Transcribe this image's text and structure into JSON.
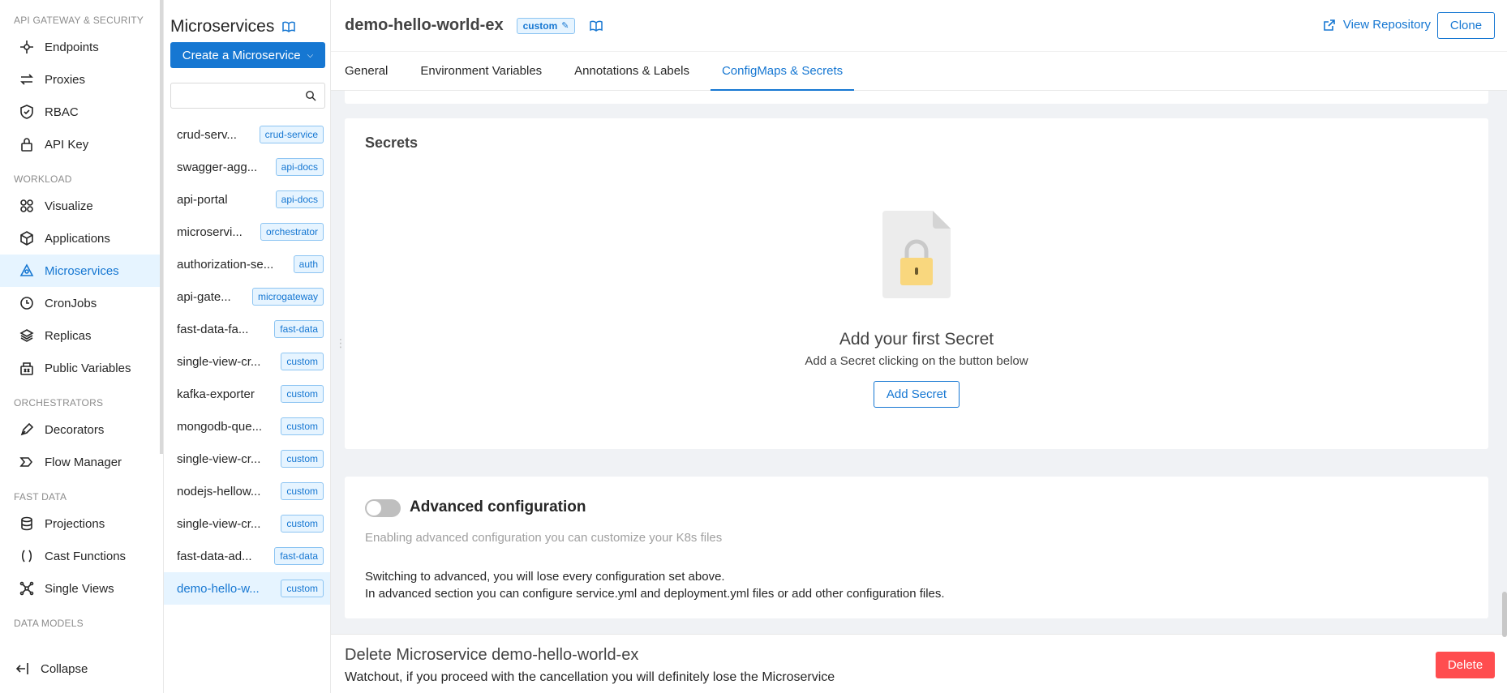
{
  "nav": {
    "sections": [
      {
        "title": "API GATEWAY & SECURITY",
        "items": [
          {
            "label": "Endpoints",
            "icon": "endpoints-icon"
          },
          {
            "label": "Proxies",
            "icon": "proxies-icon"
          },
          {
            "label": "RBAC",
            "icon": "shield-icon"
          },
          {
            "label": "API Key",
            "icon": "lock-icon"
          }
        ]
      },
      {
        "title": "WORKLOAD",
        "items": [
          {
            "label": "Visualize",
            "icon": "visualize-icon"
          },
          {
            "label": "Applications",
            "icon": "cube-icon"
          },
          {
            "label": "Microservices",
            "icon": "microservices-icon",
            "active": true
          },
          {
            "label": "CronJobs",
            "icon": "clock-icon"
          },
          {
            "label": "Replicas",
            "icon": "layers-icon"
          },
          {
            "label": "Public Variables",
            "icon": "variables-icon"
          }
        ]
      },
      {
        "title": "ORCHESTRATORS",
        "items": [
          {
            "label": "Decorators",
            "icon": "pen-icon"
          },
          {
            "label": "Flow Manager",
            "icon": "flow-icon"
          }
        ]
      },
      {
        "title": "FAST DATA",
        "items": [
          {
            "label": "Projections",
            "icon": "database-icon"
          },
          {
            "label": "Cast Functions",
            "icon": "parentheses-icon"
          },
          {
            "label": "Single Views",
            "icon": "nodes-icon"
          }
        ]
      },
      {
        "title": "DATA MODELS",
        "items": []
      }
    ],
    "collapse_label": "Collapse"
  },
  "microservices": {
    "title": "Microservices",
    "create_label": "Create a Microservice",
    "search_placeholder": "",
    "items": [
      {
        "name": "crud-serv...",
        "tag": "crud-service"
      },
      {
        "name": "swagger-agg...",
        "tag": "api-docs"
      },
      {
        "name": "api-portal",
        "tag": "api-docs"
      },
      {
        "name": "microservi...",
        "tag": "orchestrator"
      },
      {
        "name": "authorization-se...",
        "tag": "auth"
      },
      {
        "name": "api-gate...",
        "tag": "microgateway"
      },
      {
        "name": "fast-data-fa...",
        "tag": "fast-data"
      },
      {
        "name": "single-view-cr...",
        "tag": "custom"
      },
      {
        "name": "kafka-exporter",
        "tag": "custom"
      },
      {
        "name": "mongodb-que...",
        "tag": "custom"
      },
      {
        "name": "single-view-cr...",
        "tag": "custom"
      },
      {
        "name": "nodejs-hellow...",
        "tag": "custom"
      },
      {
        "name": "single-view-cr...",
        "tag": "custom"
      },
      {
        "name": "fast-data-ad...",
        "tag": "fast-data"
      },
      {
        "name": "demo-hello-w...",
        "tag": "custom",
        "active": true
      }
    ]
  },
  "header": {
    "title": "demo-hello-world-ex",
    "tag": "custom",
    "view_repo_label": "View Repository",
    "clone_label": "Clone"
  },
  "tabs": [
    {
      "label": "General"
    },
    {
      "label": "Environment Variables"
    },
    {
      "label": "Annotations & Labels"
    },
    {
      "label": "ConfigMaps & Secrets",
      "active": true
    }
  ],
  "secrets": {
    "title": "Secrets",
    "empty_title": "Add your first Secret",
    "empty_sub": "Add a Secret clicking on the button below",
    "add_label": "Add Secret"
  },
  "advanced": {
    "title": "Advanced configuration",
    "enabled": false,
    "desc": "Enabling advanced configuration you can customize your K8s files",
    "note_line1": "Switching to advanced, you will lose every configuration set above.",
    "note_line2": "In advanced section you can configure service.yml and deployment.yml files or add other configuration files."
  },
  "danger": {
    "title": "Delete Microservice demo-hello-world-ex",
    "sub": "Watchout, if you proceed with the cancellation you will definitely lose the Microservice",
    "delete_label": "Delete"
  },
  "colors": {
    "accent": "#1677d2",
    "danger": "#ff4d4f",
    "active_bg": "#e6f4ff"
  }
}
